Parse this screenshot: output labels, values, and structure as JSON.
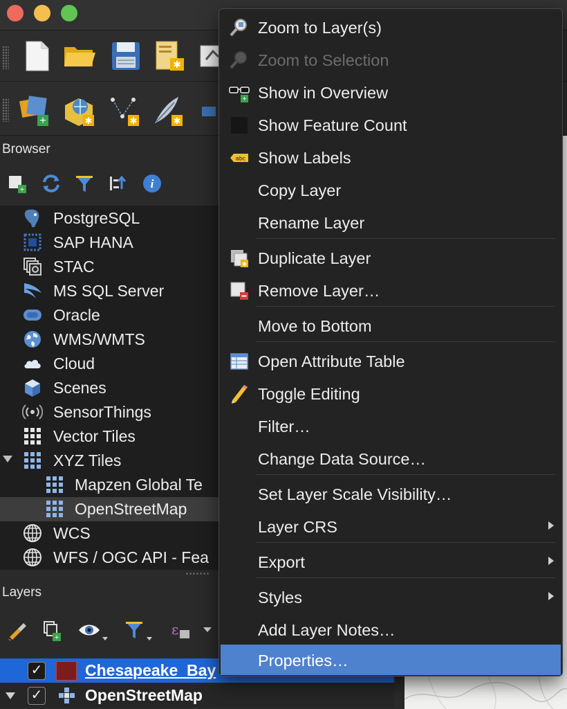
{
  "browser": {
    "title": "Browser",
    "items": [
      {
        "label": "PostgreSQL",
        "icon": "postgresql-elephant-icon"
      },
      {
        "label": "SAP HANA",
        "icon": "sap-hana-icon"
      },
      {
        "label": "STAC",
        "icon": "stac-icon"
      },
      {
        "label": "MS SQL Server",
        "icon": "mssql-icon"
      },
      {
        "label": "Oracle",
        "icon": "oracle-icon"
      },
      {
        "label": "WMS/WMTS",
        "icon": "globe-icon"
      },
      {
        "label": "Cloud",
        "icon": "cloud-icon"
      },
      {
        "label": "Scenes",
        "icon": "cube-icon"
      },
      {
        "label": "SensorThings",
        "icon": "sensor-signal-icon"
      },
      {
        "label": "Vector Tiles",
        "icon": "grid-tiles-icon"
      },
      {
        "label": "XYZ Tiles",
        "icon": "grid-tiles-icon"
      },
      {
        "label": "Mapzen Global Te",
        "icon": "grid-tiles-icon"
      },
      {
        "label": "OpenStreetMap",
        "icon": "grid-tiles-icon"
      },
      {
        "label": "WCS",
        "icon": "globe-icon"
      },
      {
        "label": "WFS / OGC API - Fea",
        "icon": "globe-icon"
      }
    ]
  },
  "layers": {
    "title": "Layers",
    "rows": [
      {
        "name": "Chesapeake_Bay",
        "checked": "✓",
        "swatch_color": "#7b1d1d"
      },
      {
        "name": "OpenStreetMap",
        "checked": "✓"
      }
    ]
  },
  "context_menu": {
    "items": [
      {
        "label": "Zoom to Layer(s)",
        "icon": "zoom-layer-icon"
      },
      {
        "label": "Zoom to Selection",
        "icon": "zoom-selection-icon",
        "disabled": true
      },
      {
        "label": "Show in Overview",
        "icon": "overview-glasses-icon"
      },
      {
        "label": "Show Feature Count",
        "icon": "feature-count-icon"
      },
      {
        "label": "Show Labels",
        "icon": "labels-abc-icon"
      },
      {
        "label": "Copy Layer"
      },
      {
        "label": "Rename Layer"
      },
      {
        "label": "Duplicate Layer",
        "icon": "duplicate-layer-icon"
      },
      {
        "label": "Remove Layer…",
        "icon": "remove-layer-icon"
      },
      {
        "label": "Move to Bottom"
      },
      {
        "label": "Open Attribute Table",
        "icon": "attribute-table-icon"
      },
      {
        "label": "Toggle Editing",
        "icon": "pencil-icon"
      },
      {
        "label": "Filter…"
      },
      {
        "label": "Change Data Source…"
      },
      {
        "label": "Set Layer Scale Visibility…"
      },
      {
        "label": "Layer CRS",
        "submenu": true
      },
      {
        "label": "Export",
        "submenu": true
      },
      {
        "label": "Styles",
        "submenu": true
      },
      {
        "label": "Add Layer Notes…"
      },
      {
        "label": "Properties…",
        "highlighted": true
      }
    ]
  }
}
